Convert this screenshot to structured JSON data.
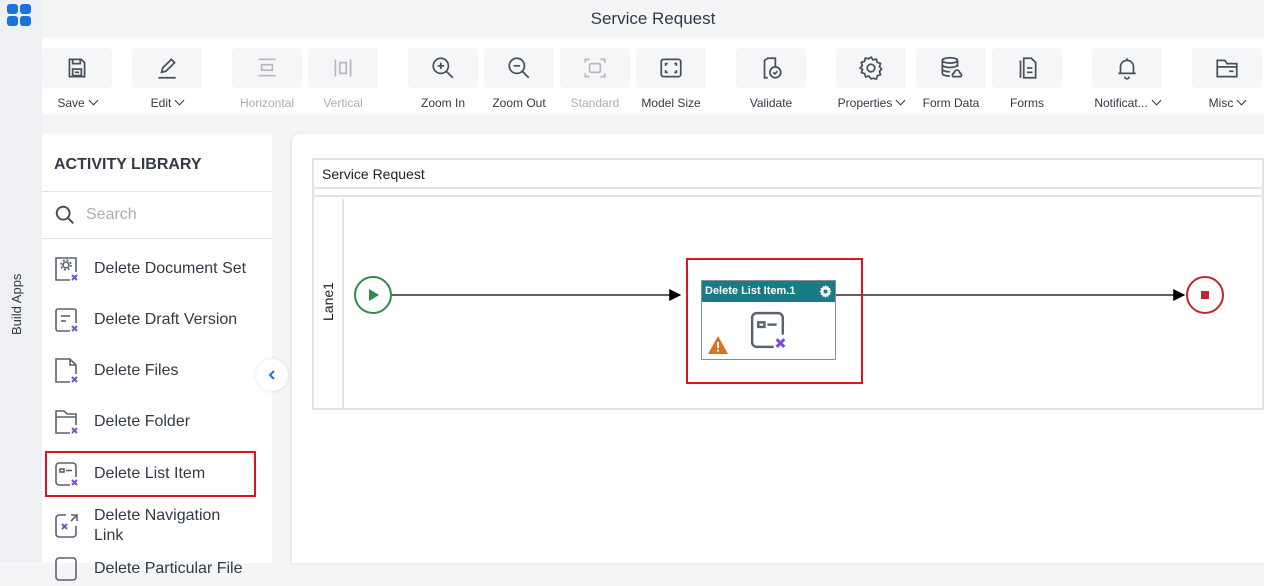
{
  "app": {
    "title": "Service Request",
    "side_rail_label": "Build Apps"
  },
  "toolbar": {
    "items": [
      {
        "label": "Save",
        "icon": "save-icon",
        "dropdown": true,
        "disabled": false
      },
      {
        "label": "Edit",
        "icon": "edit-icon",
        "dropdown": true,
        "disabled": false
      },
      {
        "label": "Horizontal",
        "icon": "horizontal-icon",
        "dropdown": false,
        "disabled": true
      },
      {
        "label": "Vertical",
        "icon": "vertical-icon",
        "dropdown": false,
        "disabled": true
      },
      {
        "label": "Zoom In",
        "icon": "zoom-in-icon",
        "dropdown": false,
        "disabled": false
      },
      {
        "label": "Zoom Out",
        "icon": "zoom-out-icon",
        "dropdown": false,
        "disabled": false
      },
      {
        "label": "Standard",
        "icon": "standard-icon",
        "dropdown": false,
        "disabled": true
      },
      {
        "label": "Model Size",
        "icon": "model-size-icon",
        "dropdown": false,
        "disabled": false
      },
      {
        "label": "Validate",
        "icon": "validate-icon",
        "dropdown": false,
        "disabled": false
      },
      {
        "label": "Properties",
        "icon": "gear-icon",
        "dropdown": true,
        "disabled": false
      },
      {
        "label": "Form Data",
        "icon": "database-icon",
        "dropdown": false,
        "disabled": false
      },
      {
        "label": "Forms",
        "icon": "forms-icon",
        "dropdown": false,
        "disabled": false
      },
      {
        "label": "Notificat...",
        "icon": "bell-icon",
        "dropdown": true,
        "disabled": false
      },
      {
        "label": "Misc",
        "icon": "folder-icon",
        "dropdown": true,
        "disabled": false
      }
    ]
  },
  "library": {
    "heading": "ACTIVITY LIBRARY",
    "search_placeholder": "Search",
    "search_value": "",
    "items": [
      {
        "label": "Delete Document Set",
        "icon": "delete-document-set-icon",
        "selected": false
      },
      {
        "label": "Delete Draft Version",
        "icon": "delete-draft-version-icon",
        "selected": false
      },
      {
        "label": "Delete Files",
        "icon": "delete-files-icon",
        "selected": false
      },
      {
        "label": "Delete Folder",
        "icon": "delete-folder-icon",
        "selected": false
      },
      {
        "label": "Delete List Item",
        "icon": "delete-list-item-icon",
        "selected": true
      },
      {
        "label": "Delete Navigation Link",
        "icon": "delete-navigation-link-icon",
        "selected": false
      },
      {
        "label": "Delete Particular File",
        "icon": "delete-particular-file-icon",
        "selected": false
      }
    ]
  },
  "canvas": {
    "pool_title": "Service Request",
    "lane_label": "Lane1",
    "task": {
      "title": "Delete List Item.1",
      "has_warning": true,
      "selected": true
    },
    "colors": {
      "task_header": "#177c83",
      "start": "#2e8b4e",
      "end": "#c1272d",
      "highlight": "#e0141e",
      "warning": "#e07020",
      "x_mark": "#7b4fd6"
    }
  }
}
